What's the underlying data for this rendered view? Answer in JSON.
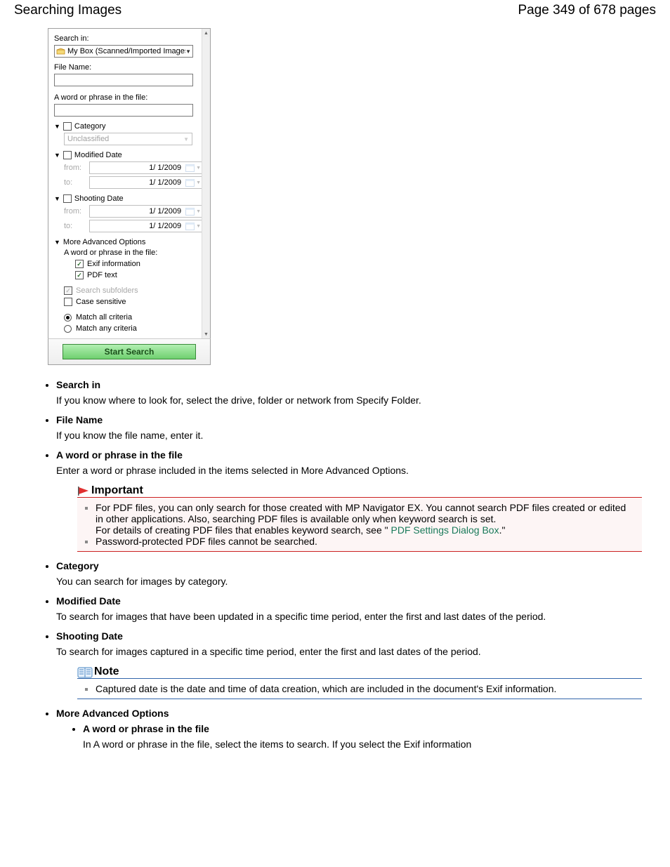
{
  "header": {
    "title": "Searching Images",
    "page_indicator": "Page 349 of 678 pages"
  },
  "dialog": {
    "search_in": {
      "label": "Search in:",
      "value": "My Box (Scanned/Imported Images)"
    },
    "file_name": {
      "label": "File Name:"
    },
    "word_phrase": {
      "label": "A word or phrase in the file:"
    },
    "category": {
      "label": "Category",
      "value": "Unclassified"
    },
    "modified_date": {
      "label": "Modified Date",
      "from_label": "from:",
      "to_label": "to:",
      "from_value": "1/  1/2009",
      "to_value": "1/  1/2009"
    },
    "shooting_date": {
      "label": "Shooting Date",
      "from_label": "from:",
      "to_label": "to:",
      "from_value": "1/  1/2009",
      "to_value": "1/  1/2009"
    },
    "more_adv": {
      "label": "More Advanced Options",
      "sublabel": "A word or phrase in the file:",
      "exif": "Exif information",
      "pdf": "PDF text"
    },
    "search_subfolders": "Search subfolders",
    "case_sensitive": "Case sensitive",
    "match_all": "Match all criteria",
    "match_any": "Match any criteria",
    "start_button": "Start Search"
  },
  "doc": {
    "items": {
      "search_in": {
        "term": "Search in",
        "desc": "If you know where to look for, select the drive, folder or network from Specify Folder."
      },
      "file_name": {
        "term": "File Name",
        "desc": "If you know the file name, enter it."
      },
      "word_phrase": {
        "term": "A word or phrase in the file",
        "desc": "Enter a word or phrase included in the items selected in More Advanced Options."
      },
      "category": {
        "term": "Category",
        "desc": "You can search for images by category."
      },
      "modified_date": {
        "term": "Modified Date",
        "desc": "To search for images that have been updated in a specific time period, enter the first and last dates of the period."
      },
      "shooting_date": {
        "term": "Shooting Date",
        "desc": "To search for images captured in a specific time period, enter the first and last dates of the period."
      },
      "more_adv": {
        "term": "More Advanced Options"
      },
      "sub_word": {
        "term": "A word or phrase in the file",
        "desc": "In A word or phrase in the file, select the items to search. If you select the Exif information"
      }
    },
    "important": {
      "title": "Important",
      "li1a": "For PDF files, you can only search for those created with MP Navigator EX. You cannot search PDF files created or edited in other applications. Also, searching PDF files is available only when keyword search is set.",
      "li1b_prefix": "For details of creating PDF files that enables keyword search, see \" ",
      "li1b_link": "PDF Settings Dialog Box",
      "li1b_suffix": ".\"",
      "li2": "Password-protected PDF files cannot be searched."
    },
    "note": {
      "title": "Note",
      "li1": "Captured date is the date and time of data creation, which are included in the document's Exif information."
    }
  }
}
